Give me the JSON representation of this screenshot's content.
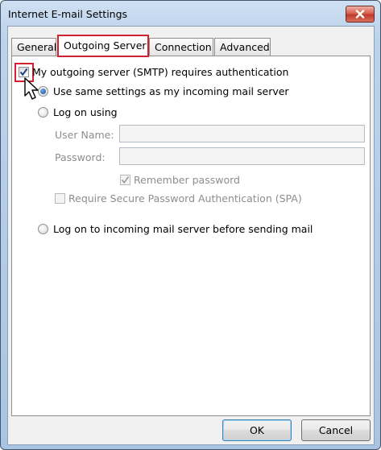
{
  "window": {
    "title": "Internet E-mail Settings"
  },
  "tabs": [
    {
      "label": "General",
      "selected": false
    },
    {
      "label": "Outgoing Server",
      "selected": true
    },
    {
      "label": "Connection",
      "selected": false
    },
    {
      "label": "Advanced",
      "selected": false
    }
  ],
  "outgoing": {
    "smtp_auth": {
      "label": "My outgoing server (SMTP) requires authentication",
      "checked": true
    },
    "use_same": {
      "label": "Use same settings as my incoming mail server",
      "selected": true
    },
    "log_on_using": {
      "label": "Log on using",
      "selected": false
    },
    "user_name": {
      "label": "User Name:",
      "value": ""
    },
    "password": {
      "label": "Password:",
      "value": ""
    },
    "remember_password": {
      "label": "Remember password",
      "checked": true,
      "enabled": false
    },
    "spa": {
      "label": "Require Secure Password Authentication (SPA)",
      "checked": false,
      "enabled": false
    },
    "log_on_incoming": {
      "label": "Log on to incoming mail server before sending mail",
      "selected": false
    }
  },
  "buttons": {
    "ok": "OK",
    "cancel": "Cancel"
  },
  "colors": {
    "highlight": "#d1202f",
    "window_frame": "#a9c4e3",
    "close_button": "#c0392b"
  },
  "icons": {
    "close": "close-icon",
    "cursor": "mouse-pointer-icon"
  }
}
